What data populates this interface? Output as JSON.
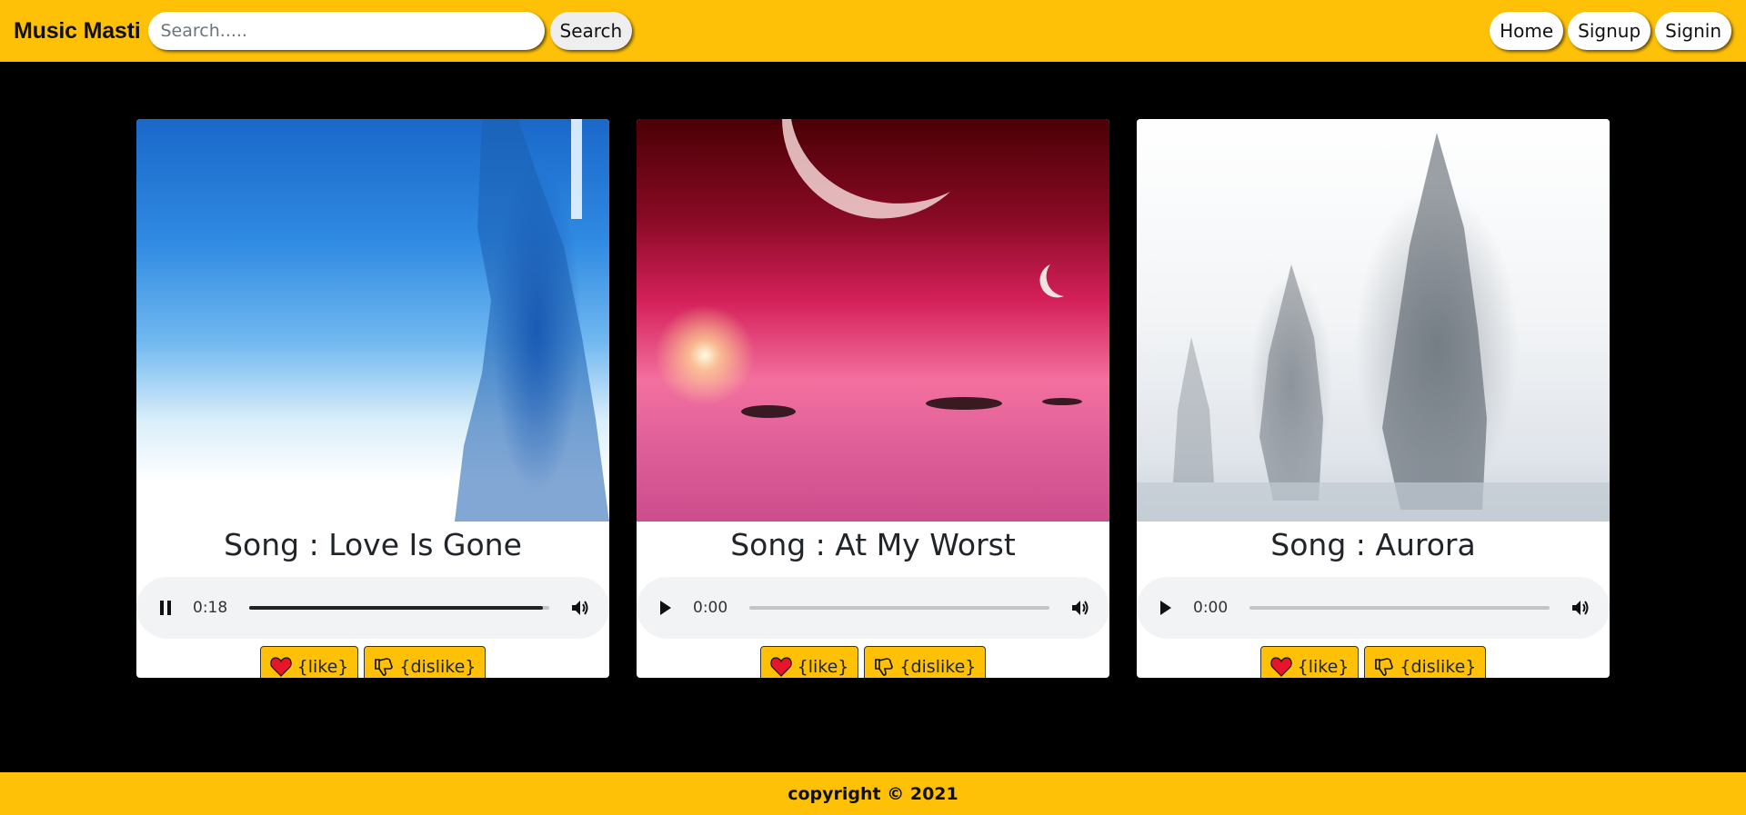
{
  "header": {
    "brand": "Music Masti",
    "search": {
      "placeholder": "Search.....",
      "value": ""
    },
    "search_button": "Search",
    "nav": [
      {
        "label": "Home"
      },
      {
        "label": "Signup"
      },
      {
        "label": "Signin"
      }
    ]
  },
  "cards": [
    {
      "title": "Song : Love Is Gone",
      "player": {
        "state": "playing",
        "time": "0:18",
        "progress": 0.98
      },
      "like_label": "{like}",
      "dislike_label": "{dislike}"
    },
    {
      "title": "Song : At My Worst",
      "player": {
        "state": "paused",
        "time": "0:00",
        "progress": 0
      },
      "like_label": "{like}",
      "dislike_label": "{dislike}"
    },
    {
      "title": "Song : Aurora",
      "player": {
        "state": "paused",
        "time": "0:00",
        "progress": 0
      },
      "like_label": "{like}",
      "dislike_label": "{dislike}"
    }
  ],
  "footer": {
    "copyright": "copyright © 2021"
  },
  "colors": {
    "accent": "#ffc107",
    "background": "#000000",
    "heart": "#e8142b"
  },
  "icons": {
    "like": "heart-icon",
    "dislike": "thumbs-down-icon",
    "play": "play-icon",
    "pause": "pause-icon",
    "volume": "volume-icon"
  }
}
